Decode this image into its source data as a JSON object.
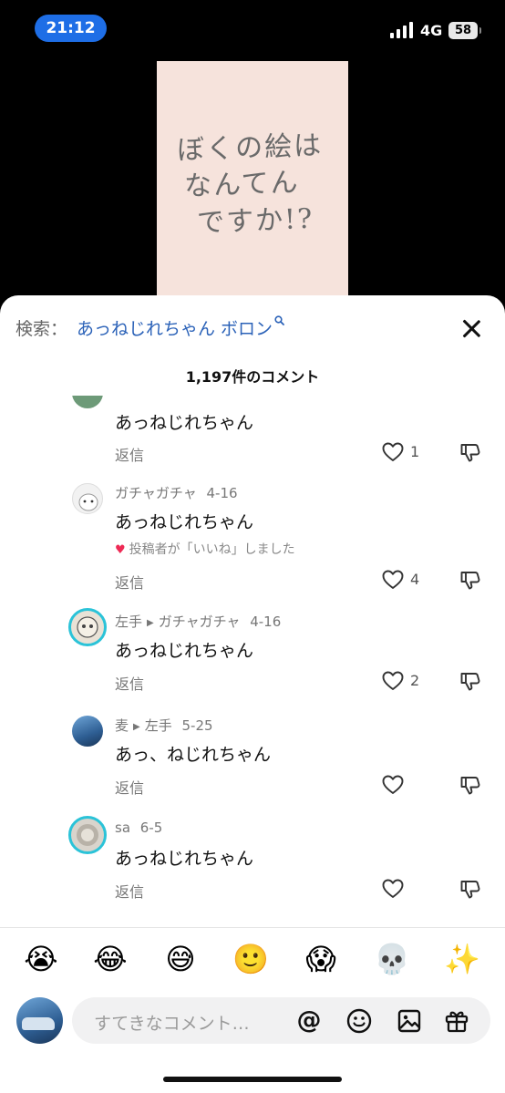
{
  "status_bar": {
    "time": "21:12",
    "network": "4G",
    "battery": "58"
  },
  "video": {
    "line1": "ぼくの絵は",
    "line2": "なんてん",
    "line3": "ですか!?"
  },
  "search": {
    "label": "検索：",
    "query": "あっねじれちゃん ボロン"
  },
  "comments_header": {
    "count": "1,197件のコメント"
  },
  "comments": [
    {
      "author": "",
      "date": "",
      "text": "あっねじれちゃん",
      "reply_label": "返信",
      "likes": "1"
    },
    {
      "author": "ガチャガチャ",
      "date": "4-16",
      "text": "あっねじれちゃん",
      "liked_by_creator": "投稿者が「いいね」しました",
      "reply_label": "返信",
      "likes": "4"
    },
    {
      "author": "左手",
      "reply_to": "ガチャガチャ",
      "date": "4-16",
      "text": "あっねじれちゃん",
      "reply_label": "返信",
      "likes": "2"
    },
    {
      "author": "麦",
      "reply_to": "左手",
      "date": "5-25",
      "text": "あっ、ねじれちゃん",
      "reply_label": "返信",
      "likes": ""
    },
    {
      "author": "sa",
      "date": "6-5",
      "text": "あっねじれちゃん",
      "reply_label": "返信",
      "likes": ""
    }
  ],
  "emojis": [
    "😭",
    "😂",
    "😅",
    "🙂",
    "😱",
    "💀",
    "✨"
  ],
  "composer": {
    "placeholder": "すてきなコメント…",
    "at": "@"
  },
  "colors": {
    "link": "#2b62b8",
    "time_pill": "#1e6ee6",
    "heart": "#ee2a55",
    "avatar_ring": "#2bc3d8"
  }
}
